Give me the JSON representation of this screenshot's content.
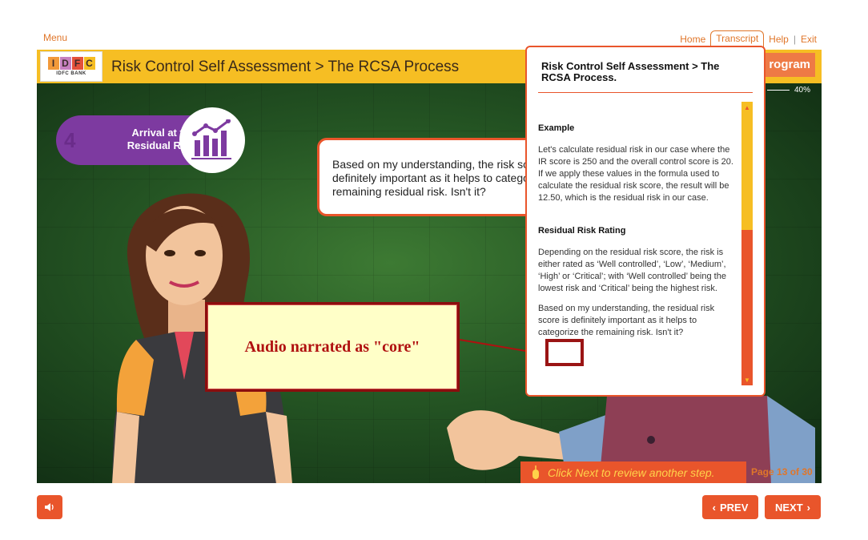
{
  "topnav": {
    "menu": "Menu",
    "home": "Home",
    "transcript": "Transcript",
    "help": "Help",
    "exit": "Exit",
    "separator": "|"
  },
  "header": {
    "logo_letters": [
      "I",
      "D",
      "F",
      "C"
    ],
    "logo_sub": "IDFC BANK",
    "title": "Risk Control Self Assessment > The RCSA Process",
    "program_tag": "rogram",
    "progress": "40%"
  },
  "step": {
    "number": "4",
    "label_line1": "Arrival at the",
    "label_line2": "Residual Risk",
    "icon": "bar-chart-icon"
  },
  "speech_bubble": "Based on my understanding, the risk score is definitely important as it helps to categorize the remaining residual risk. Isn't it?",
  "annotation": "Audio narrated as \"core\"",
  "transcript_panel": {
    "title": "Risk Control Self Assessment > The RCSA Process.",
    "sections": [
      {
        "heading": "Example",
        "text": "Let's calculate residual risk in our case where the IR score is 250 and the overall control score is 20. If we apply these values in the formula used to calculate the residual risk score, the result will be 12.50, which is the residual risk in our case."
      },
      {
        "heading": "Residual Risk Rating",
        "text": "Depending on the residual risk score, the risk is either rated as ‘Well controlled’, ‘Low’, ‘Medium’, ‘High’ or ‘Critical’; with ‘Well controlled’ being the lowest risk and ‘Critical’ being the highest risk."
      }
    ],
    "closing": "Based on my understanding, the residual risk score is definitely important as it helps to categorize the remaining risk. Isn't it?"
  },
  "footer": {
    "hint": "Click Next to review another step.",
    "page_prefix": "Page ",
    "page_current": "13",
    "page_of": " of ",
    "page_total": "30",
    "prev": "PREV",
    "next": "NEXT"
  },
  "colors": {
    "accent": "#e9552b",
    "header_yellow": "#f6be23",
    "purple": "#7d3aa0",
    "annotation_red": "#b01010"
  }
}
